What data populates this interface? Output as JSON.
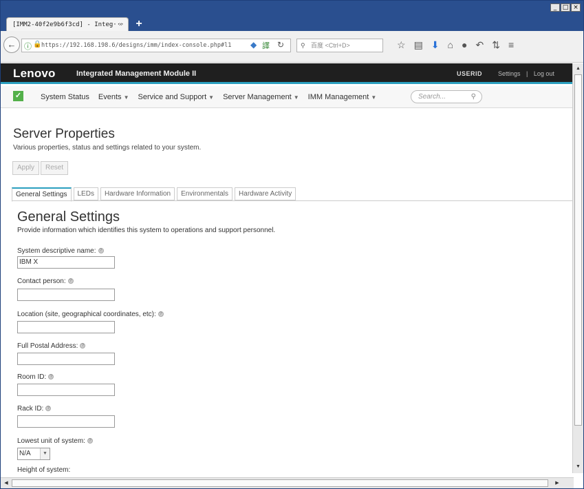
{
  "browser": {
    "tab_title": "[IMM2-40f2e9b6f3cd] - Integ···",
    "tab_close": "×",
    "new_tab": "+",
    "back_glyph": "←",
    "url": "https://192.168.198.6/designs/imm/index-console.php#l1",
    "search_placeholder": "百度 <Ctrl+D>",
    "window_buttons": [
      "_",
      "□",
      "×"
    ],
    "icons": [
      "star-icon",
      "reading-list-icon",
      "download-icon",
      "home-icon",
      "chat-icon",
      "undo-icon",
      "tools-icon",
      "menu-icon"
    ],
    "glyphs": [
      "☆",
      "▤",
      "⬇",
      "⌂",
      "●",
      "↶",
      "⇅",
      "≡"
    ]
  },
  "imm": {
    "brand": "Lenovo",
    "product": "Integrated Management Module II",
    "user": "USERID",
    "settings_link": "Settings",
    "separator": "|",
    "logout_link": "Log out"
  },
  "menu": {
    "items": [
      {
        "label": "System Status",
        "caret": false
      },
      {
        "label": "Events",
        "caret": true
      },
      {
        "label": "Service and Support",
        "caret": true
      },
      {
        "label": "Server Management",
        "caret": true
      },
      {
        "label": "IMM Management",
        "caret": true
      }
    ],
    "search_placeholder": "Search..."
  },
  "page": {
    "title": "Server Properties",
    "subtitle": "Various properties, status and settings related to your system.",
    "apply_label": "Apply",
    "reset_label": "Reset",
    "tabs": [
      "General Settings",
      "LEDs",
      "Hardware Information",
      "Environmentals",
      "Hardware Activity"
    ],
    "active_tab": 0
  },
  "general": {
    "title": "General Settings",
    "description": "Provide information which identifies this system to operations and support personnel.",
    "fields": [
      {
        "label": "System descriptive name:",
        "value": "IBM X"
      },
      {
        "label": "Contact person:",
        "value": ""
      },
      {
        "label": "Location (site, geographical coordinates, etc):",
        "value": ""
      },
      {
        "label": "Full Postal Address:",
        "value": ""
      },
      {
        "label": "Room ID:",
        "value": ""
      },
      {
        "label": "Rack ID:",
        "value": ""
      }
    ],
    "lowest_unit_label": "Lowest unit of system:",
    "lowest_unit_value": "N/A",
    "next_label_partial": "Height of system:"
  }
}
